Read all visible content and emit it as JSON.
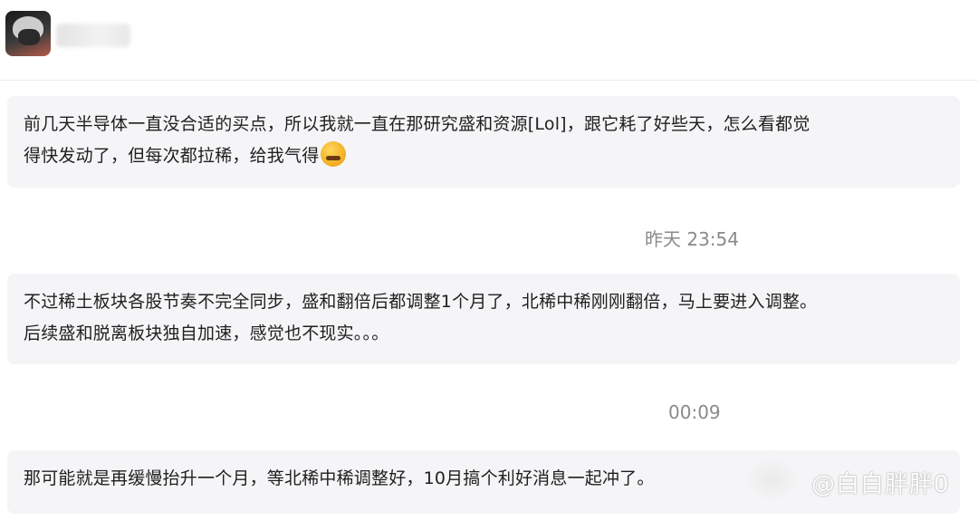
{
  "messages": [
    {
      "lines": [
        "前几天半导体一直没合适的买点，所以我就一直在那研究盛和资源[Lol]，跟它耗了好些天，怎么看都觉",
        "得快发动了，但每次都拉稀，给我气得"
      ]
    },
    {
      "lines": [
        "不过稀土板块各股节奏不完全同步，盛和翻倍后都调整1个月了，北稀中稀刚刚翻倍，马上要进入调整。",
        "后续盛和脱离板块独自加速，感觉也不现实。。。"
      ]
    },
    {
      "lines": [
        "那可能就是再缓慢抬升一个月，等北稀中稀调整好，10月搞个利好消息一起冲了。"
      ]
    }
  ],
  "timestamps": [
    "昨天 23:54",
    "00:09"
  ],
  "emoji_icon": "emoji-angry-face-icon",
  "watermark": "@白白胖胖0"
}
